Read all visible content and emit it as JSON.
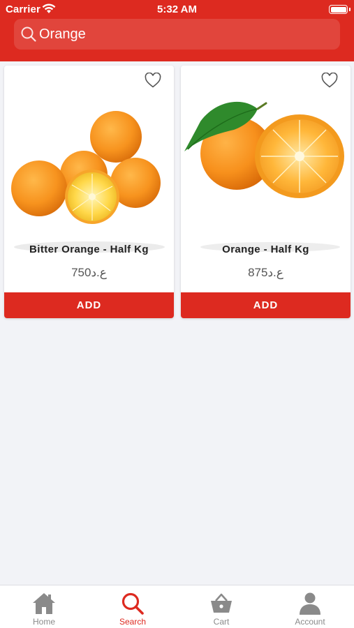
{
  "status_bar": {
    "carrier": "Carrier",
    "time": "5:32 AM"
  },
  "search": {
    "value": "Orange"
  },
  "products": [
    {
      "name": "Bitter Orange - Half Kg",
      "price": "750ع.د",
      "add_label": "ADD"
    },
    {
      "name": "Orange - Half Kg",
      "price": "875ع.د",
      "add_label": "ADD"
    }
  ],
  "tabs": [
    {
      "label": "Home",
      "icon": "home-icon",
      "active": false
    },
    {
      "label": "Search",
      "icon": "search-icon",
      "active": true
    },
    {
      "label": "Cart",
      "icon": "basket-icon",
      "active": false
    },
    {
      "label": "Account",
      "icon": "person-icon",
      "active": false
    }
  ],
  "colors": {
    "brand": "#dd2a20",
    "background": "#f2f3f7",
    "inactive_tab": "#8a8a8a"
  }
}
